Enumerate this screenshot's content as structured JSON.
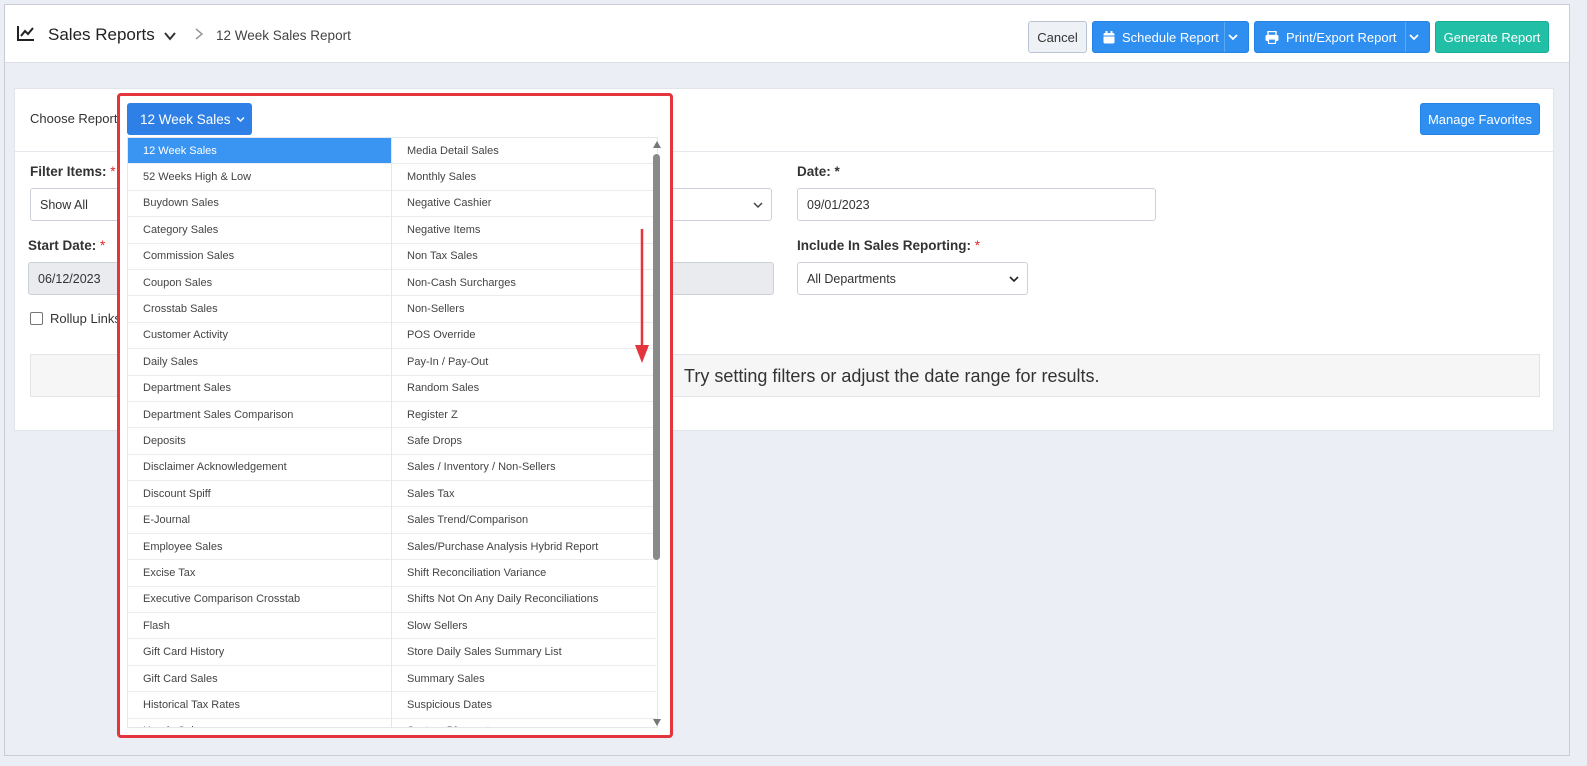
{
  "header": {
    "title": "Sales Reports",
    "breadcrumb": "12 Week Sales Report",
    "cancel_label": "Cancel",
    "schedule_label": "Schedule Report",
    "print_label": "Print/Export Report",
    "generate_label": "Generate Report",
    "colors": {
      "blue": "#2e8ff0",
      "teal": "#20bfa6"
    },
    "icons": [
      "chart-line-icon",
      "chevron-down-icon",
      "chevron-right-icon",
      "calendar-icon",
      "printer-icon"
    ]
  },
  "form": {
    "choose_report_label": "Choose Report",
    "selected_report": "12 Week Sales",
    "manage_favorites_label": "Manage Favorites",
    "filter_items_label": "Filter Items:",
    "filter_items_value": "Show All",
    "date_label": "Date:",
    "date_required": "*",
    "date_value": "09/01/2023",
    "start_date_label": "Start Date:",
    "start_date_value": "06/12/2023",
    "include_label": "Include In Sales Reporting:",
    "include_value": "All Departments",
    "required_mark": "*",
    "rollup_label": "Rollup Links",
    "notice_text": "Try setting filters or adjust the date range for results."
  },
  "dropdown": {
    "left_items": [
      "12 Week Sales",
      "52 Weeks High & Low",
      "Buydown Sales",
      "Category Sales",
      "Commission Sales",
      "Coupon Sales",
      "Crosstab Sales",
      "Customer Activity",
      "Daily Sales",
      "Department Sales",
      "Department Sales Comparison",
      "Deposits",
      "Disclaimer Acknowledgement",
      "Discount Spiff",
      "E-Journal",
      "Employee Sales",
      "Excise Tax",
      "Executive Comparison Crosstab",
      "Flash",
      "Gift Card History",
      "Gift Card Sales",
      "Historical Tax Rates",
      "Hourly Sales"
    ],
    "right_items": [
      "Media Detail Sales",
      "Monthly Sales",
      "Negative Cashier",
      "Negative Items",
      "Non Tax Sales",
      "Non-Cash Surcharges",
      "Non-Sellers",
      "POS Override",
      "Pay-In / Pay-Out",
      "Random Sales",
      "Register Z",
      "Safe Drops",
      "Sales / Inventory / Non-Sellers",
      "Sales Tax",
      "Sales Trend/Comparison",
      "Sales/Purchase Analysis Hybrid Report",
      "Shift Reconciliation Variance",
      "Shifts Not On Any Daily Reconciliations",
      "Slow Sellers",
      "Store Daily Sales Summary List",
      "Summary Sales",
      "Suspicious Dates",
      "System Discounts"
    ],
    "highlight_color": "#e3353b",
    "active_color": "#3a95f2"
  }
}
